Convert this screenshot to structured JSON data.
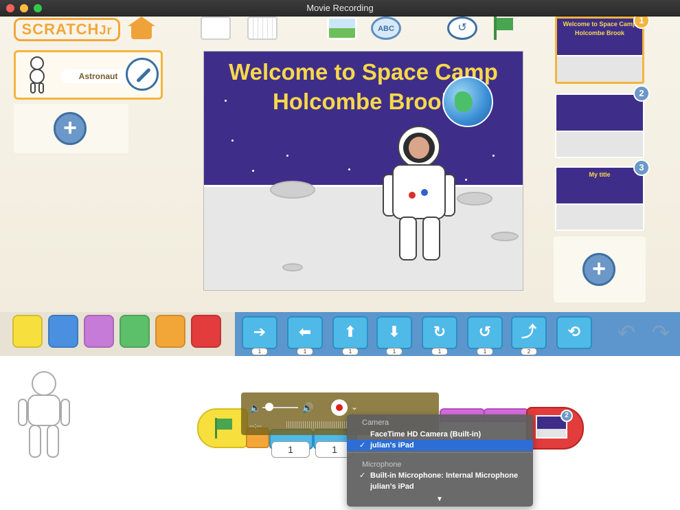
{
  "window": {
    "title": "Movie Recording"
  },
  "logo": {
    "text": "SCRATCH",
    "suffix": "Jr"
  },
  "sprite": {
    "name": "Astronaut"
  },
  "stage": {
    "title_line1": "Welcome to Space Camp",
    "title_line2": "Holcombe Brook"
  },
  "pages": [
    {
      "number": "1",
      "title_line1": "Welcome to Space Camp",
      "title_line2": "Holcombe Brook"
    },
    {
      "number": "2",
      "title_line1": "",
      "title_line2": ""
    },
    {
      "number": "3",
      "title_line1": "My title",
      "title_line2": ""
    }
  ],
  "palette": {
    "categories": [
      "triggering",
      "motion",
      "looks",
      "sound",
      "control",
      "end"
    ],
    "category_colors": [
      "#f7df3d",
      "#4a8fe0",
      "#c77bd8",
      "#5cc06a",
      "#f3a638",
      "#e33c3c"
    ],
    "motion_blocks": [
      {
        "icon": "move-right-icon",
        "value": "1"
      },
      {
        "icon": "move-left-icon",
        "value": "1"
      },
      {
        "icon": "move-up-icon",
        "value": "1"
      },
      {
        "icon": "move-down-icon",
        "value": "1"
      },
      {
        "icon": "turn-right-icon",
        "value": "1"
      },
      {
        "icon": "turn-left-icon",
        "value": "1"
      },
      {
        "icon": "hop-icon",
        "value": "2"
      },
      {
        "icon": "go-home-icon",
        "value": ""
      }
    ]
  },
  "script": {
    "block_values": [
      "1",
      "1"
    ],
    "end_page": "2"
  },
  "recorder": {
    "time": "--:--",
    "menu": {
      "camera_header": "Camera",
      "cameras": [
        {
          "label": "FaceTime HD Camera (Built-in)",
          "checked": false
        },
        {
          "label": "julian's iPad",
          "checked": true
        }
      ],
      "mic_header": "Microphone",
      "microphones": [
        {
          "label": "Built-in Microphone: Internal Microphone",
          "checked": true
        },
        {
          "label": "julian's iPad",
          "checked": false
        }
      ],
      "check_glyph": "✓"
    }
  }
}
